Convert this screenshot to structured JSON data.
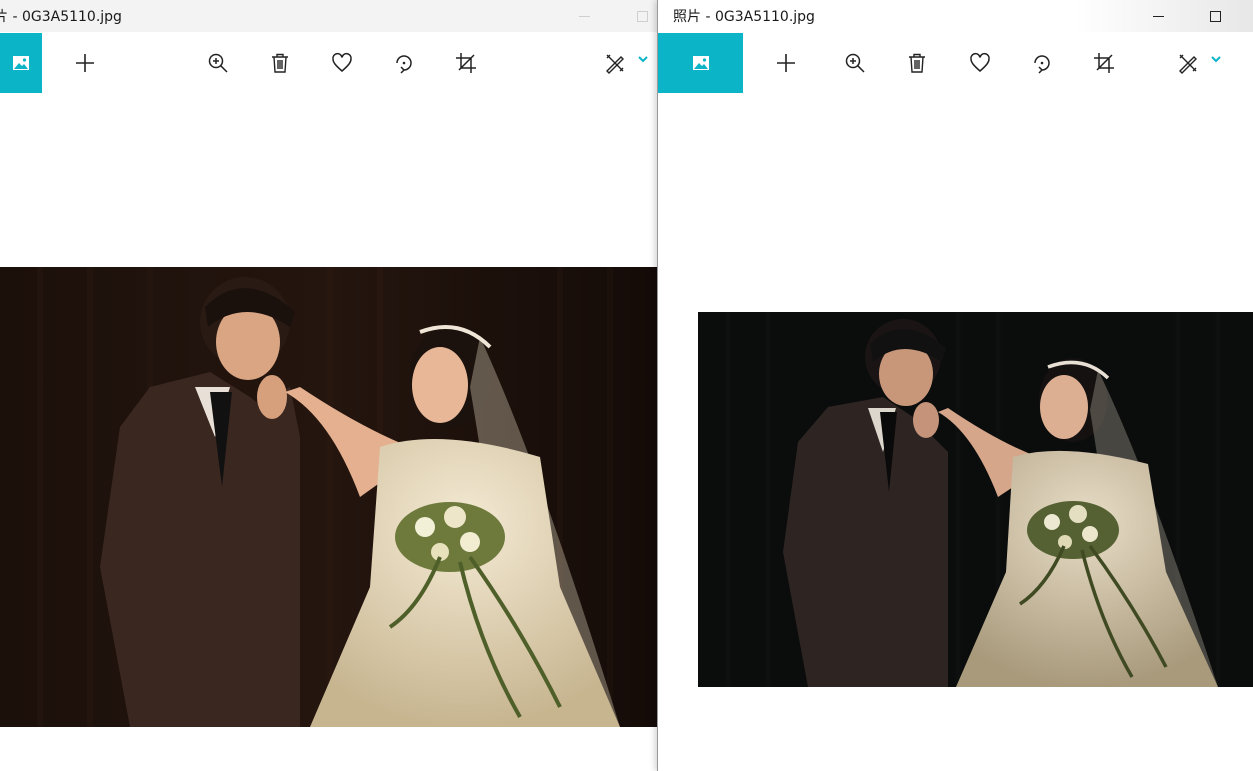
{
  "windows": [
    {
      "title": "片 - 0G3A5110.jpg",
      "toolbar": {
        "photo_icon": "photo-icon",
        "add": "plus-icon",
        "zoom": "zoom-in-icon",
        "delete": "trash-icon",
        "favorite": "heart-icon",
        "rotate": "rotate-icon",
        "crop": "crop-icon",
        "edit": "edit-draw-icon"
      }
    },
    {
      "title": "照片 - 0G3A5110.jpg",
      "toolbar": {
        "photo_icon": "photo-icon",
        "add": "plus-icon",
        "zoom": "zoom-in-icon",
        "delete": "trash-icon",
        "favorite": "heart-icon",
        "rotate": "rotate-icon",
        "crop": "crop-icon",
        "edit": "edit-draw-icon"
      }
    }
  ],
  "colors": {
    "accent": "#0bb4c6",
    "icon": "#222222",
    "photo_bg_warm": "#1a0f0b",
    "photo_bg_dark": "#0a0b0b"
  }
}
